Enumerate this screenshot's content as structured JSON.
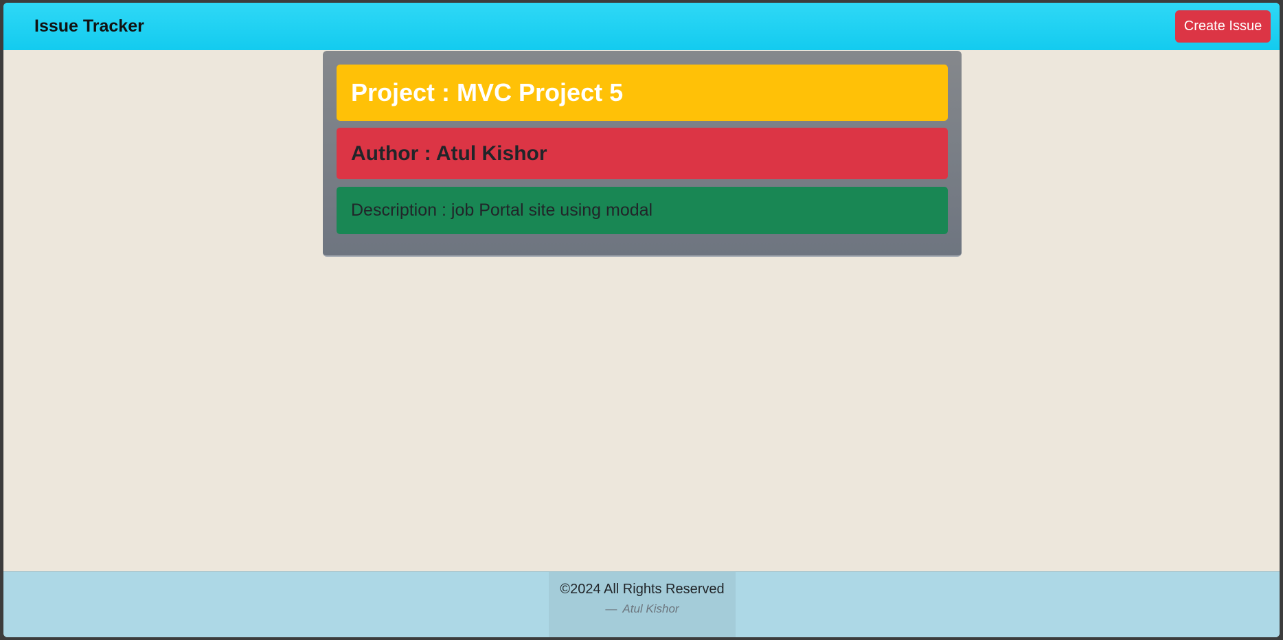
{
  "navbar": {
    "brand": "Issue Tracker",
    "create_label": "Create Issue"
  },
  "project_card": {
    "project": "Project : MVC Project 5",
    "author": "Author : Atul Kishor",
    "description": "Description : job Portal site using modal"
  },
  "footer": {
    "copyright": "©2024 All Rights Reserved",
    "dash": "—",
    "signature": "Atul Kishor"
  },
  "colors": {
    "navbar": "#13cbef",
    "create_button": "#dc3545",
    "project_row": "#ffc107",
    "author_row": "#dc3545",
    "description_row": "#198754",
    "footer": "#add8e6",
    "page_background": "#ede7dc"
  }
}
